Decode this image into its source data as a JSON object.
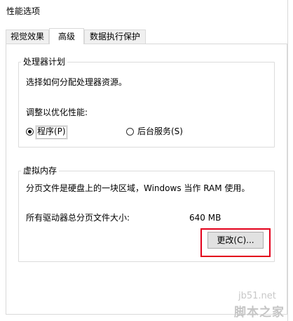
{
  "window": {
    "title": "性能选项"
  },
  "tabs": [
    {
      "label": "视觉效果",
      "selected": false
    },
    {
      "label": "高级",
      "selected": true
    },
    {
      "label": "数据执行保护",
      "selected": false
    }
  ],
  "processor_scheduling": {
    "legend": "处理器计划",
    "description": "选择如何分配处理器资源。",
    "adjust_label": "调整以优化性能:",
    "options": [
      {
        "label": "程序(P)",
        "selected": true
      },
      {
        "label": "后台服务(S)",
        "selected": false
      }
    ]
  },
  "virtual_memory": {
    "legend": "虚拟内存",
    "description": "分页文件是硬盘上的一块区域，Windows 当作 RAM 使用。",
    "total_label": "所有驱动器总分页文件大小:",
    "total_value": "640 MB",
    "change_button": "更改(C)..."
  },
  "watermark": {
    "site": "jb51.net",
    "brand": "脚本之家"
  },
  "colors": {
    "highlight": "#e3001b",
    "panel_border": "#d9d9d9"
  }
}
